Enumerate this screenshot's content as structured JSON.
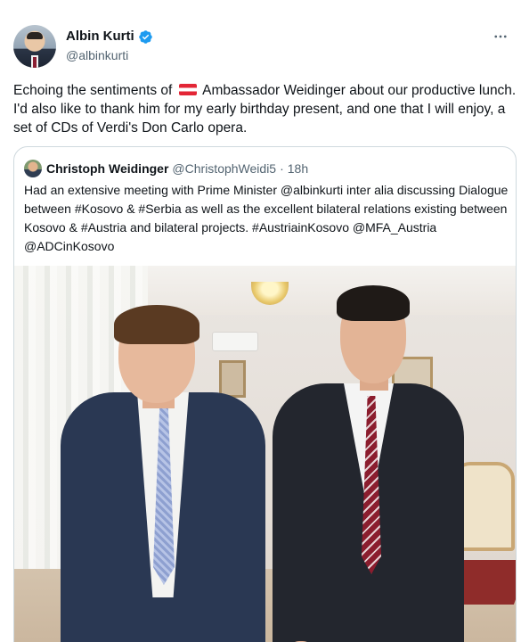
{
  "author": {
    "display_name": "Albin Kurti",
    "handle": "@albinkurti",
    "verified": true
  },
  "menu_icon": "more-horizontal-icon",
  "tweet": {
    "text_before_flag": "Echoing the sentiments of",
    "flag": "austria-flag-icon",
    "text_after_flag": " Ambassador Weidinger about our productive lunch. I'd also like to thank him for my early birthday present, and one that I will enjoy, a set of CDs of Verdi's Don Carlo opera."
  },
  "quoted_tweet": {
    "display_name": "Christoph Weidinger",
    "handle": "@ChristophWeidi5",
    "separator": "·",
    "time": "18h",
    "text": "Had an extensive meeting with Prime Minister @albinkurti inter alia discussing Dialogue between #Kosovo  & #Serbia as well as the excellent bilateral relations existing between Kosovo & #Austria and bilateral projects. #AustriainKosovo @MFA_Austria @ADCinKosovo"
  },
  "colors": {
    "verified": "#1d9bf0",
    "text_primary": "#0f1419",
    "text_secondary": "#536471",
    "border": "#cfd9de"
  }
}
